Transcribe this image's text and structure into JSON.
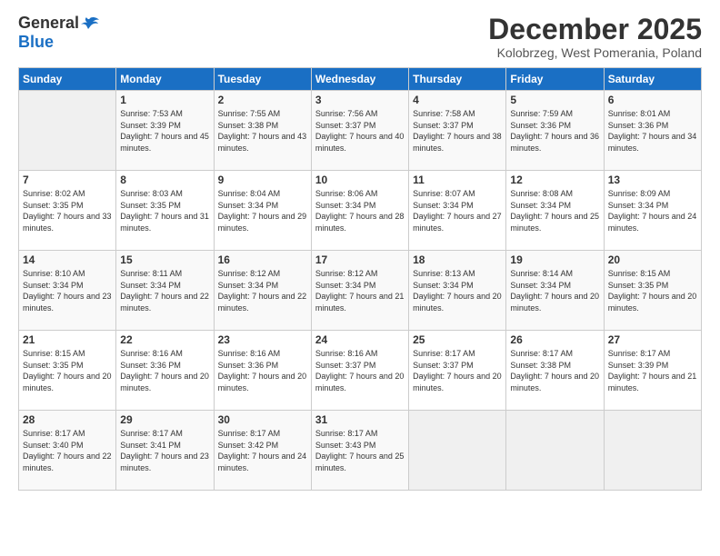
{
  "header": {
    "logo_general": "General",
    "logo_blue": "Blue",
    "month_title": "December 2025",
    "location": "Kolobrzeg, West Pomerania, Poland"
  },
  "weekdays": [
    "Sunday",
    "Monday",
    "Tuesday",
    "Wednesday",
    "Thursday",
    "Friday",
    "Saturday"
  ],
  "weeks": [
    [
      {
        "day": "",
        "sunrise": "",
        "sunset": "",
        "daylight": ""
      },
      {
        "day": "1",
        "sunrise": "Sunrise: 7:53 AM",
        "sunset": "Sunset: 3:39 PM",
        "daylight": "Daylight: 7 hours and 45 minutes."
      },
      {
        "day": "2",
        "sunrise": "Sunrise: 7:55 AM",
        "sunset": "Sunset: 3:38 PM",
        "daylight": "Daylight: 7 hours and 43 minutes."
      },
      {
        "day": "3",
        "sunrise": "Sunrise: 7:56 AM",
        "sunset": "Sunset: 3:37 PM",
        "daylight": "Daylight: 7 hours and 40 minutes."
      },
      {
        "day": "4",
        "sunrise": "Sunrise: 7:58 AM",
        "sunset": "Sunset: 3:37 PM",
        "daylight": "Daylight: 7 hours and 38 minutes."
      },
      {
        "day": "5",
        "sunrise": "Sunrise: 7:59 AM",
        "sunset": "Sunset: 3:36 PM",
        "daylight": "Daylight: 7 hours and 36 minutes."
      },
      {
        "day": "6",
        "sunrise": "Sunrise: 8:01 AM",
        "sunset": "Sunset: 3:36 PM",
        "daylight": "Daylight: 7 hours and 34 minutes."
      }
    ],
    [
      {
        "day": "7",
        "sunrise": "Sunrise: 8:02 AM",
        "sunset": "Sunset: 3:35 PM",
        "daylight": "Daylight: 7 hours and 33 minutes."
      },
      {
        "day": "8",
        "sunrise": "Sunrise: 8:03 AM",
        "sunset": "Sunset: 3:35 PM",
        "daylight": "Daylight: 7 hours and 31 minutes."
      },
      {
        "day": "9",
        "sunrise": "Sunrise: 8:04 AM",
        "sunset": "Sunset: 3:34 PM",
        "daylight": "Daylight: 7 hours and 29 minutes."
      },
      {
        "day": "10",
        "sunrise": "Sunrise: 8:06 AM",
        "sunset": "Sunset: 3:34 PM",
        "daylight": "Daylight: 7 hours and 28 minutes."
      },
      {
        "day": "11",
        "sunrise": "Sunrise: 8:07 AM",
        "sunset": "Sunset: 3:34 PM",
        "daylight": "Daylight: 7 hours and 27 minutes."
      },
      {
        "day": "12",
        "sunrise": "Sunrise: 8:08 AM",
        "sunset": "Sunset: 3:34 PM",
        "daylight": "Daylight: 7 hours and 25 minutes."
      },
      {
        "day": "13",
        "sunrise": "Sunrise: 8:09 AM",
        "sunset": "Sunset: 3:34 PM",
        "daylight": "Daylight: 7 hours and 24 minutes."
      }
    ],
    [
      {
        "day": "14",
        "sunrise": "Sunrise: 8:10 AM",
        "sunset": "Sunset: 3:34 PM",
        "daylight": "Daylight: 7 hours and 23 minutes."
      },
      {
        "day": "15",
        "sunrise": "Sunrise: 8:11 AM",
        "sunset": "Sunset: 3:34 PM",
        "daylight": "Daylight: 7 hours and 22 minutes."
      },
      {
        "day": "16",
        "sunrise": "Sunrise: 8:12 AM",
        "sunset": "Sunset: 3:34 PM",
        "daylight": "Daylight: 7 hours and 22 minutes."
      },
      {
        "day": "17",
        "sunrise": "Sunrise: 8:12 AM",
        "sunset": "Sunset: 3:34 PM",
        "daylight": "Daylight: 7 hours and 21 minutes."
      },
      {
        "day": "18",
        "sunrise": "Sunrise: 8:13 AM",
        "sunset": "Sunset: 3:34 PM",
        "daylight": "Daylight: 7 hours and 20 minutes."
      },
      {
        "day": "19",
        "sunrise": "Sunrise: 8:14 AM",
        "sunset": "Sunset: 3:34 PM",
        "daylight": "Daylight: 7 hours and 20 minutes."
      },
      {
        "day": "20",
        "sunrise": "Sunrise: 8:15 AM",
        "sunset": "Sunset: 3:35 PM",
        "daylight": "Daylight: 7 hours and 20 minutes."
      }
    ],
    [
      {
        "day": "21",
        "sunrise": "Sunrise: 8:15 AM",
        "sunset": "Sunset: 3:35 PM",
        "daylight": "Daylight: 7 hours and 20 minutes."
      },
      {
        "day": "22",
        "sunrise": "Sunrise: 8:16 AM",
        "sunset": "Sunset: 3:36 PM",
        "daylight": "Daylight: 7 hours and 20 minutes."
      },
      {
        "day": "23",
        "sunrise": "Sunrise: 8:16 AM",
        "sunset": "Sunset: 3:36 PM",
        "daylight": "Daylight: 7 hours and 20 minutes."
      },
      {
        "day": "24",
        "sunrise": "Sunrise: 8:16 AM",
        "sunset": "Sunset: 3:37 PM",
        "daylight": "Daylight: 7 hours and 20 minutes."
      },
      {
        "day": "25",
        "sunrise": "Sunrise: 8:17 AM",
        "sunset": "Sunset: 3:37 PM",
        "daylight": "Daylight: 7 hours and 20 minutes."
      },
      {
        "day": "26",
        "sunrise": "Sunrise: 8:17 AM",
        "sunset": "Sunset: 3:38 PM",
        "daylight": "Daylight: 7 hours and 20 minutes."
      },
      {
        "day": "27",
        "sunrise": "Sunrise: 8:17 AM",
        "sunset": "Sunset: 3:39 PM",
        "daylight": "Daylight: 7 hours and 21 minutes."
      }
    ],
    [
      {
        "day": "28",
        "sunrise": "Sunrise: 8:17 AM",
        "sunset": "Sunset: 3:40 PM",
        "daylight": "Daylight: 7 hours and 22 minutes."
      },
      {
        "day": "29",
        "sunrise": "Sunrise: 8:17 AM",
        "sunset": "Sunset: 3:41 PM",
        "daylight": "Daylight: 7 hours and 23 minutes."
      },
      {
        "day": "30",
        "sunrise": "Sunrise: 8:17 AM",
        "sunset": "Sunset: 3:42 PM",
        "daylight": "Daylight: 7 hours and 24 minutes."
      },
      {
        "day": "31",
        "sunrise": "Sunrise: 8:17 AM",
        "sunset": "Sunset: 3:43 PM",
        "daylight": "Daylight: 7 hours and 25 minutes."
      },
      {
        "day": "",
        "sunrise": "",
        "sunset": "",
        "daylight": ""
      },
      {
        "day": "",
        "sunrise": "",
        "sunset": "",
        "daylight": ""
      },
      {
        "day": "",
        "sunrise": "",
        "sunset": "",
        "daylight": ""
      }
    ]
  ]
}
